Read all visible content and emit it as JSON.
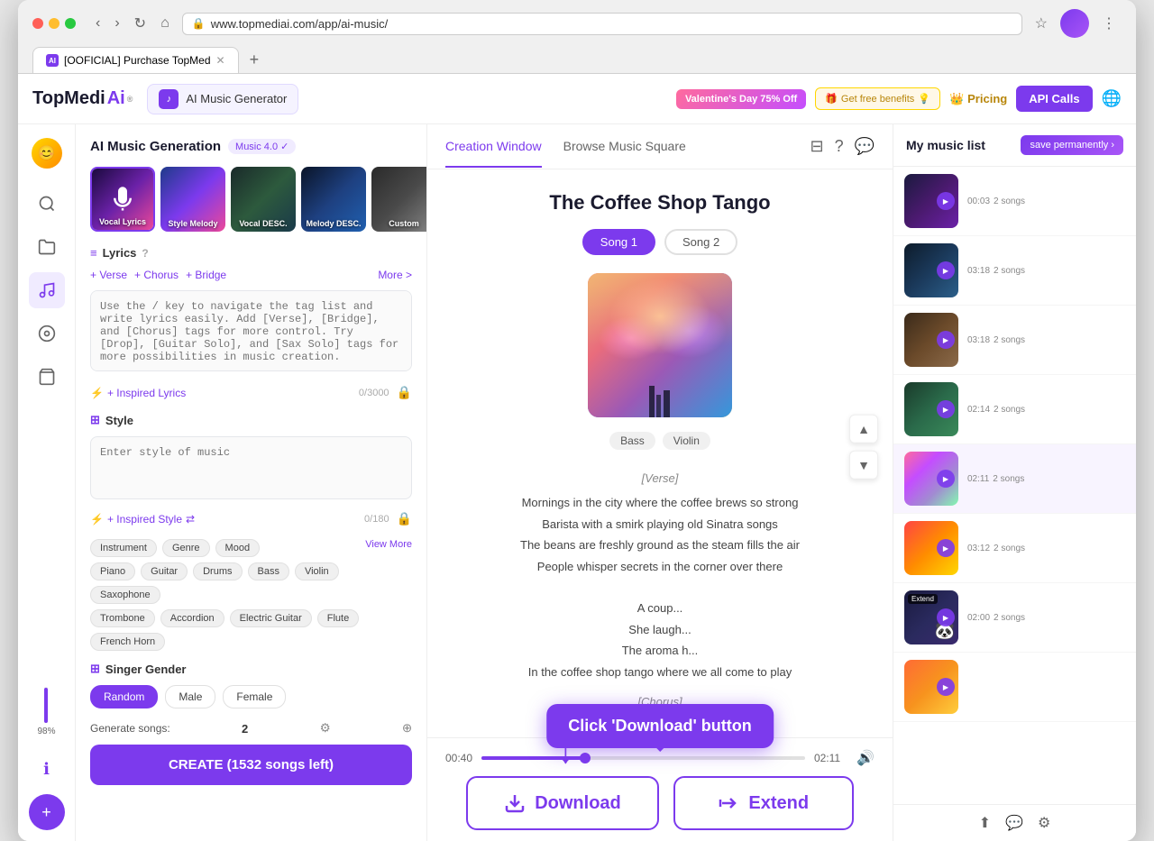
{
  "browser": {
    "url": "www.topmediai.com/app/ai-music/",
    "tab_title": "[OOFICIAL] Purchase TopMed",
    "tab_favicon": "AI"
  },
  "navbar": {
    "brand": "TopMedi",
    "brand_ai": "Ai",
    "brand_trademark": "®",
    "app_name": "AI Music Generator",
    "valentine_badge": "Valentine's Day 75% Off",
    "free_benefits": "Get free benefits",
    "pricing": "Pricing",
    "api_calls": "API Calls"
  },
  "left_panel": {
    "title": "AI Music Generation",
    "version": "Music 4.0 ✓",
    "styles": [
      {
        "label": "Vocal Lyrics",
        "bg": "1"
      },
      {
        "label": "Style Melody",
        "bg": "2"
      },
      {
        "label": "Vocal DESC.",
        "bg": "3"
      },
      {
        "label": "Melody DESC.",
        "bg": "4"
      },
      {
        "label": "Custom",
        "bg": "5"
      }
    ],
    "lyrics_section": "Lyrics",
    "verse_btn": "+ Verse",
    "chorus_btn": "+ Chorus",
    "bridge_btn": "+ Bridge",
    "more_btn": "More >",
    "lyrics_placeholder": "Use the / key to navigate the tag list and write lyrics easily. Add [Verse], [Bridge], and [Chorus] tags for more control. Try [Drop], [Guitar Solo], and [Sax Solo] tags for more possibilities in music creation.",
    "inspired_lyrics": "+ Inspired Lyrics",
    "char_count": "0/3000",
    "style_section": "Style",
    "style_placeholder": "Enter style of music",
    "style_char_count": "0/180",
    "view_more": "View More",
    "tags": [
      "Instrument",
      "Genre",
      "Mood",
      "Bass",
      "Violin",
      "Saxophone",
      "Piano",
      "Guitar",
      "Drums",
      "Trombone",
      "Accordion",
      "Electric Guitar",
      "Flute",
      "French Horn"
    ],
    "singer_section": "Singer Gender",
    "singer_options": [
      "Random",
      "Male",
      "Female"
    ],
    "singer_active": "Random",
    "generate_label": "Generate songs:",
    "generate_count": "2",
    "create_btn": "CREATE (1532 songs left)"
  },
  "center": {
    "tab_creation": "Creation Window",
    "tab_browse": "Browse Music Square",
    "song_title": "The Coffee Shop Tango",
    "song1": "Song 1",
    "song2": "Song 2",
    "tags": [
      "Bass",
      "Violin"
    ],
    "lyrics": [
      {
        "type": "section",
        "text": "[Verse]"
      },
      {
        "type": "line",
        "text": "Mornings in the city where the coffee brews so strong"
      },
      {
        "type": "line",
        "text": "Barista with a smirk playing old Sinatra songs"
      },
      {
        "type": "line",
        "text": "The beans are freshly ground as the steam fills the air"
      },
      {
        "type": "line",
        "text": "People whisper secrets in the corner over there"
      },
      {
        "type": "blank",
        "text": ""
      },
      {
        "type": "line",
        "text": "A coup..."
      },
      {
        "type": "line",
        "text": "She laugh..."
      },
      {
        "type": "line",
        "text": "The aroma h..."
      },
      {
        "type": "line",
        "text": "In the coffee shop tango where we all come to play"
      },
      {
        "type": "section",
        "text": "[Chorus]"
      }
    ],
    "time_current": "00:40",
    "time_total": "02:11",
    "download_btn": "Download",
    "extend_btn": "Extend",
    "tooltip_text": "Click 'Download' button"
  },
  "right_sidebar": {
    "title": "My music list",
    "save_btn": "save permanently ›",
    "items": [
      {
        "duration": "00:03",
        "songs": "2 songs",
        "bg": "1"
      },
      {
        "duration": "03:18",
        "songs": "2 songs",
        "bg": "2"
      },
      {
        "duration": "03:18",
        "songs": "2 songs",
        "bg": "3"
      },
      {
        "duration": "02:14",
        "songs": "2 songs",
        "bg": "4"
      },
      {
        "duration": "02:11",
        "songs": "2 songs",
        "bg": "5",
        "active": true
      },
      {
        "duration": "03:12",
        "songs": "2 songs",
        "bg": "6"
      },
      {
        "duration": "02:00",
        "songs": "2 songs",
        "bg": "7",
        "extend": true,
        "panda": true
      }
    ]
  }
}
